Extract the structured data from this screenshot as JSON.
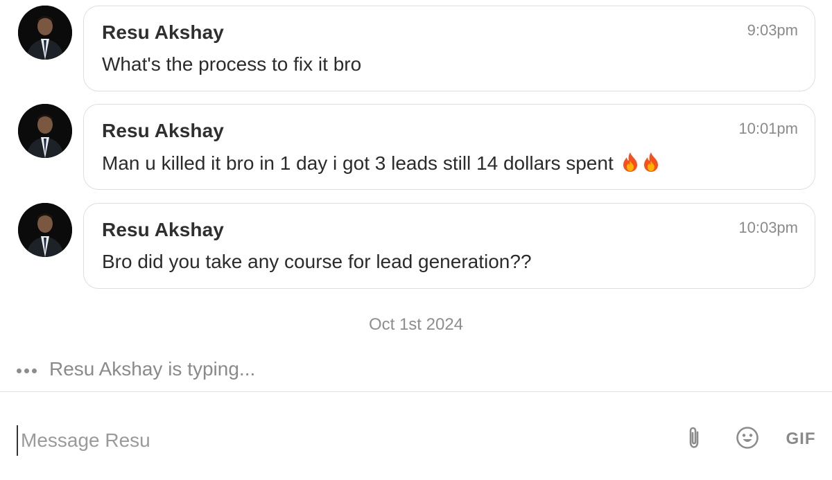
{
  "messages": [
    {
      "sender": "Resu Akshay",
      "time": "9:03pm",
      "text": "What's the process to fix it bro",
      "emoji_count": 0
    },
    {
      "sender": "Resu Akshay",
      "time": "10:01pm",
      "text": "Man u killed it bro in 1 day i got 3 leads still 14 dollars spent",
      "emoji_count": 2,
      "emoji": "fire-icon"
    },
    {
      "sender": "Resu Akshay",
      "time": "10:03pm",
      "text": "Bro did you take any course for lead generation??",
      "emoji_count": 0
    }
  ],
  "date_separator": "Oct 1st 2024",
  "typing_indicator": "Resu Akshay is typing...",
  "composer": {
    "placeholder": "Message Resu",
    "value": "",
    "attach_icon": "paperclip-icon",
    "emoji_icon": "smiley-icon",
    "gif_label": "GIF"
  },
  "colors": {
    "bubble_border": "#dedede",
    "muted_text": "#8a8a8a",
    "primary_text": "#2b2b2b"
  }
}
